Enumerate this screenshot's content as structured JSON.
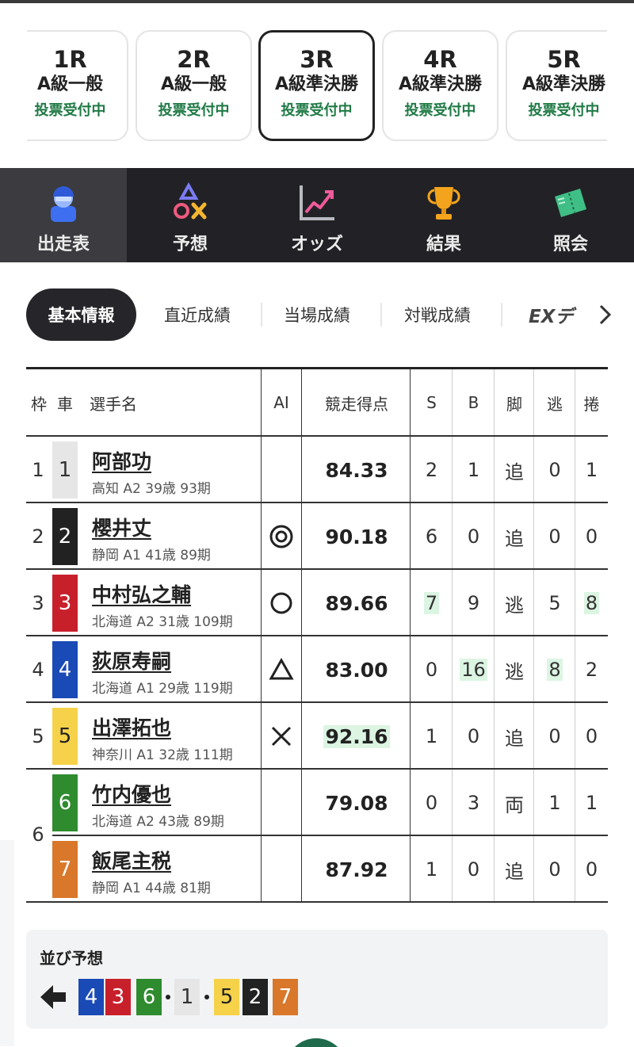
{
  "races": [
    {
      "no": "1R",
      "class": "A級一般",
      "status": "投票受付中"
    },
    {
      "no": "2R",
      "class": "A級一般",
      "status": "投票受付中"
    },
    {
      "no": "3R",
      "class": "A級準決勝",
      "status": "投票受付中"
    },
    {
      "no": "4R",
      "class": "A級準決勝",
      "status": "投票受付中"
    },
    {
      "no": "5R",
      "class": "A級準決勝",
      "status": "投票受付中"
    }
  ],
  "nav": [
    {
      "label": "出走表",
      "icon": "rider-icon"
    },
    {
      "label": "予想",
      "icon": "prediction-shapes-icon"
    },
    {
      "label": "オッズ",
      "icon": "odds-chart-icon"
    },
    {
      "label": "結果",
      "icon": "trophy-icon"
    },
    {
      "label": "照会",
      "icon": "ticket-icon"
    }
  ],
  "subtabs": [
    "基本情報",
    "直近成績",
    "当場成績",
    "対戦成績",
    "EXデ"
  ],
  "table": {
    "headers": {
      "waku": "枠",
      "car": "車",
      "name": "選手名",
      "ai": "AI",
      "score": "競走得点",
      "s": "S",
      "b": "B",
      "leg": "脚",
      "nige": "逃",
      "makuri": "捲"
    },
    "rows": [
      {
        "waku": "1",
        "car": "1",
        "name": "阿部功",
        "info": "高知 A2 39歳 93期",
        "ai": "",
        "score": "84.33",
        "s": "2",
        "b": "1",
        "leg": "追",
        "nige": "0",
        "makuri": "1"
      },
      {
        "waku": "2",
        "car": "2",
        "name": "櫻井丈",
        "info": "静岡 A1 41歳 89期",
        "ai": "◎",
        "score": "90.18",
        "s": "6",
        "b": "0",
        "leg": "追",
        "nige": "0",
        "makuri": "0"
      },
      {
        "waku": "3",
        "car": "3",
        "name": "中村弘之輔",
        "info": "北海道 A2 31歳 109期",
        "ai": "○",
        "score": "89.66",
        "s": "7",
        "b": "9",
        "leg": "逃",
        "nige": "5",
        "makuri": "8"
      },
      {
        "waku": "4",
        "car": "4",
        "name": "荻原寿嗣",
        "info": "北海道 A1 29歳 119期",
        "ai": "△",
        "score": "83.00",
        "s": "0",
        "b": "16",
        "leg": "逃",
        "nige": "8",
        "makuri": "2"
      },
      {
        "waku": "5",
        "car": "5",
        "name": "出澤拓也",
        "info": "神奈川 A1 32歳 111期",
        "ai": "×",
        "score": "92.16",
        "s": "1",
        "b": "0",
        "leg": "追",
        "nige": "0",
        "makuri": "0"
      },
      {
        "waku": "6",
        "car": "6",
        "name": "竹内優也",
        "info": "北海道 A2 43歳 89期",
        "ai": "",
        "score": "79.08",
        "s": "0",
        "b": "3",
        "leg": "両",
        "nige": "1",
        "makuri": "1"
      },
      {
        "waku": "6",
        "car": "7",
        "name": "飯尾主税",
        "info": "静岡 A1 44歳 81期",
        "ai": "",
        "score": "87.92",
        "s": "1",
        "b": "0",
        "leg": "追",
        "nige": "0",
        "makuri": "0"
      }
    ]
  },
  "narabi": {
    "title": "並び予想",
    "order": [
      "4",
      "3",
      "6",
      "1",
      "5",
      "2",
      "7"
    ]
  },
  "colors": {
    "car1": "#e6e6e6",
    "car2": "#222222",
    "car3": "#c8202b",
    "car4": "#1a4ab5",
    "car5": "#f6d24a",
    "car6": "#2e8b2e",
    "car7": "#d9772a",
    "status_green": "#1f7a45",
    "highlight": "#dcf5e3"
  }
}
